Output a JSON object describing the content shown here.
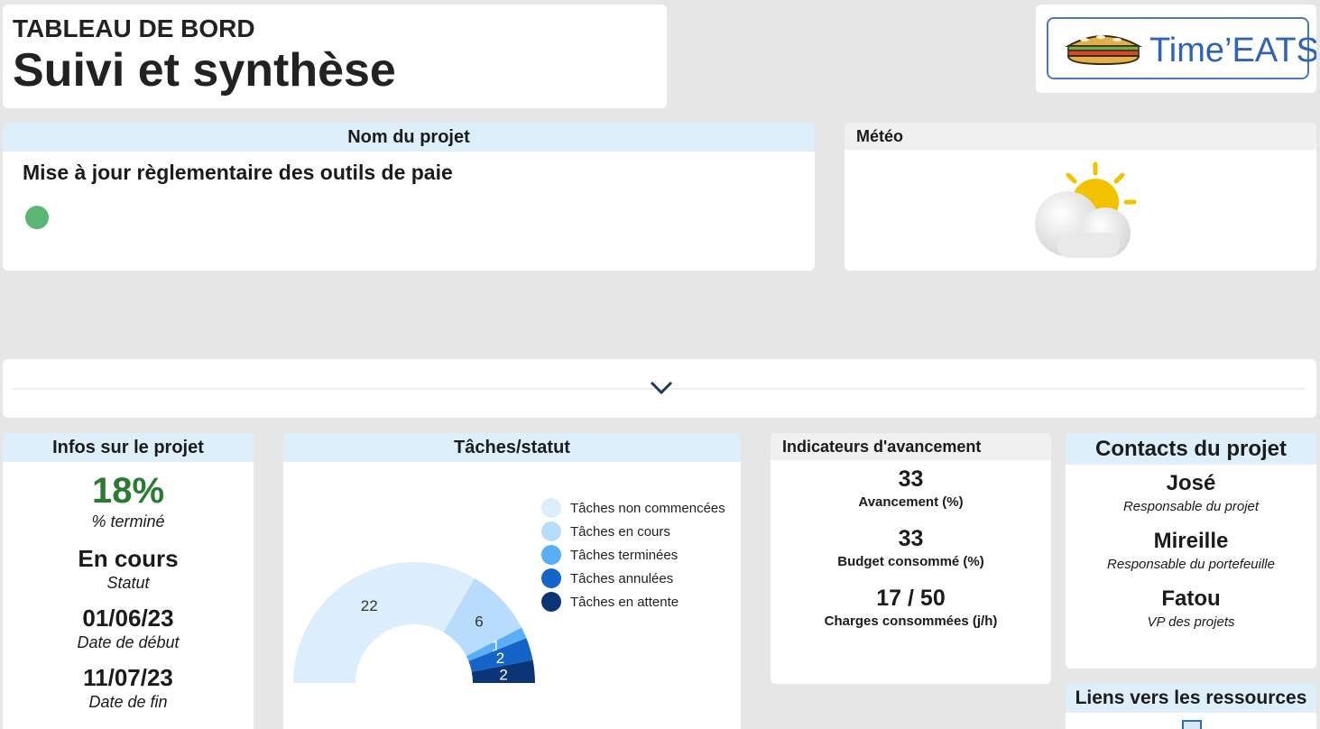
{
  "header": {
    "title_small": "TABLEAU DE BORD",
    "title_large": "Suivi et synthèse"
  },
  "logo": {
    "text": "Time’EATS",
    "icon": "sandwich-icon"
  },
  "project": {
    "band": "Nom du projet",
    "name": "Mise à jour règlementaire des outils de paie",
    "status_color": "#5cb673"
  },
  "meteo": {
    "band": "Météo",
    "icon": "sun-behind-cloud-icon"
  },
  "collapse": {
    "icon": "chevron-down-icon"
  },
  "infos": {
    "band": "Infos sur le projet",
    "percent": "18%",
    "percent_label": "% terminé",
    "status": "En cours",
    "status_label": "Statut",
    "start": "01/06/23",
    "start_label": "Date de début",
    "end": "11/07/23",
    "end_label": "Date de fin"
  },
  "tasks": {
    "band": "Tâches/statut",
    "legend": [
      {
        "label": "Tâches non commencées",
        "color": "#dcedfc"
      },
      {
        "label": "Tâches en cours",
        "color": "#b8dcfb"
      },
      {
        "label": "Tâches terminées",
        "color": "#5aaef5"
      },
      {
        "label": "Tâches annulées",
        "color": "#1565c9"
      },
      {
        "label": "Tâches en attente",
        "color": "#0c3577"
      }
    ]
  },
  "chart_data": {
    "type": "pie",
    "categories": [
      "Tâches non commencées",
      "Tâches en cours",
      "Tâches terminées",
      "Tâches annulées",
      "Tâches en attente"
    ],
    "values": [
      22,
      6,
      1,
      2,
      2
    ],
    "colors": [
      "#dcedfc",
      "#b8dcfb",
      "#5aaef5",
      "#1565c9",
      "#0c3577"
    ],
    "label_colors": [
      "#333333",
      "#333333",
      "#ffffff",
      "#ffffff",
      "#ffffff"
    ],
    "shape": "half-donut",
    "legend_position": "top-right",
    "title": ""
  },
  "indicators": {
    "band": "Indicateurs d'avancement",
    "items": [
      {
        "value": "33",
        "label": "Avancement (%)"
      },
      {
        "value": "33",
        "label": "Budget consommé (%)"
      },
      {
        "value": "17 / 50",
        "label": "Charges consommées (j/h)"
      }
    ]
  },
  "contacts": {
    "band": "Contacts du projet",
    "people": [
      {
        "name": "José",
        "role": "Responsable du projet"
      },
      {
        "name": "Mireille",
        "role": "Responsable du portefeuille"
      },
      {
        "name": "Fatou",
        "role": "VP des projets"
      }
    ]
  },
  "links": {
    "band": "Liens vers les ressources",
    "icon": "document-icon"
  }
}
